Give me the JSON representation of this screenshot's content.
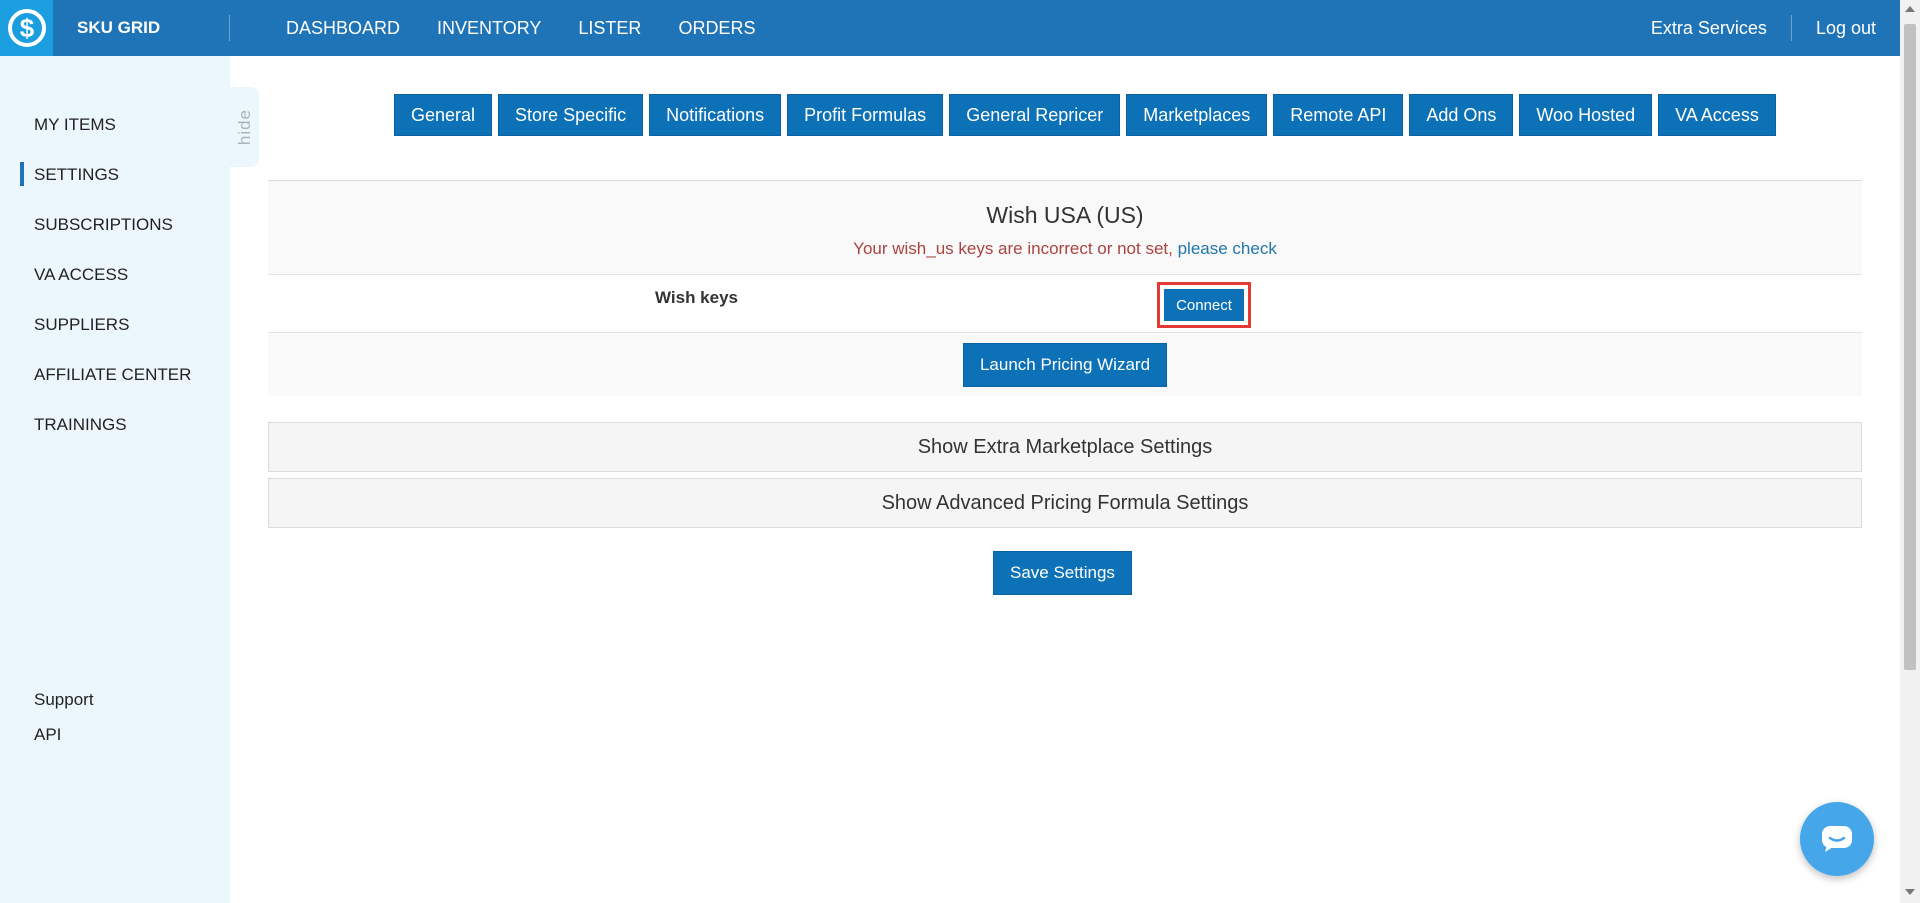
{
  "header": {
    "brand": "SKU GRID",
    "logo_icon": "dollar-logo-icon",
    "nav": [
      "DASHBOARD",
      "INVENTORY",
      "LISTER",
      "ORDERS"
    ],
    "extra_services": "Extra Services",
    "logout": "Log out"
  },
  "sidebar": {
    "items": [
      "MY ITEMS",
      "SETTINGS",
      "SUBSCRIPTIONS",
      "VA ACCESS",
      "SUPPLIERS",
      "AFFILIATE CENTER",
      "TRAININGS"
    ],
    "active": "SETTINGS",
    "hide_label": "hide",
    "bottom": [
      "Support",
      "API"
    ]
  },
  "tabs": [
    "General",
    "Store Specific",
    "Notifications",
    "Profit Formulas",
    "General Repricer",
    "Marketplaces",
    "Remote API",
    "Add Ons",
    "Woo Hosted",
    "VA Access"
  ],
  "panel": {
    "title": "Wish USA (US)",
    "warning": "Your wish_us keys are incorrect or not set, ",
    "warning_link": "please check",
    "keys_label": "Wish keys",
    "connect_label": "Connect",
    "wizard_label": "Launch Pricing Wizard"
  },
  "collapsibles": {
    "extra": "Show Extra Marketplace Settings",
    "advanced": "Show Advanced Pricing Formula Settings"
  },
  "save_label": "Save Settings",
  "colors": {
    "header_bg": "#1f73b7",
    "button_bg": "#0c71b6",
    "sidebar_bg": "#ecf6fd",
    "warning_text": "#a94442",
    "highlight_border": "#e53935"
  }
}
